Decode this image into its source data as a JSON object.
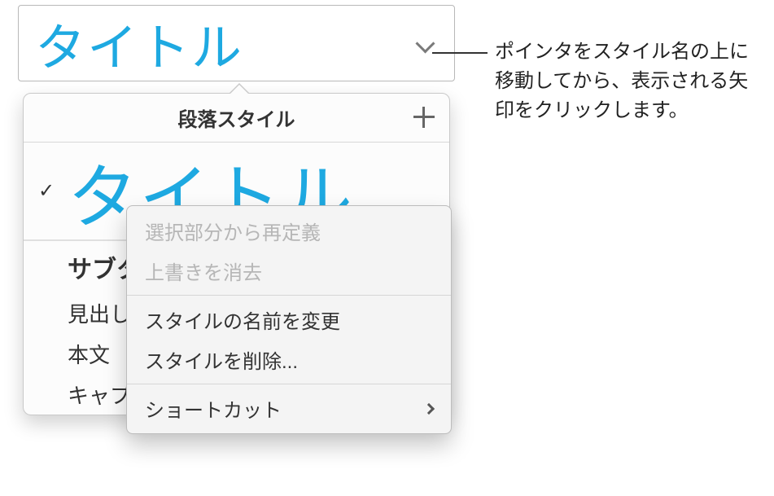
{
  "title_bar": {
    "current_style": "タイトル"
  },
  "popover": {
    "header": "段落スタイル",
    "styles": {
      "title": "タイトル",
      "subtitle": "サブタイトル",
      "heading": "見出し",
      "body": "本文",
      "caption": "キャプション"
    }
  },
  "context_menu": {
    "redefine": "選択部分から再定義",
    "clear_override": "上書きを消去",
    "rename": "スタイルの名前を変更",
    "delete": "スタイルを削除...",
    "shortcut": "ショートカット"
  },
  "callout": {
    "text": "ポインタをスタイル名の上に移動してから、表示される矢印をクリックします。"
  }
}
